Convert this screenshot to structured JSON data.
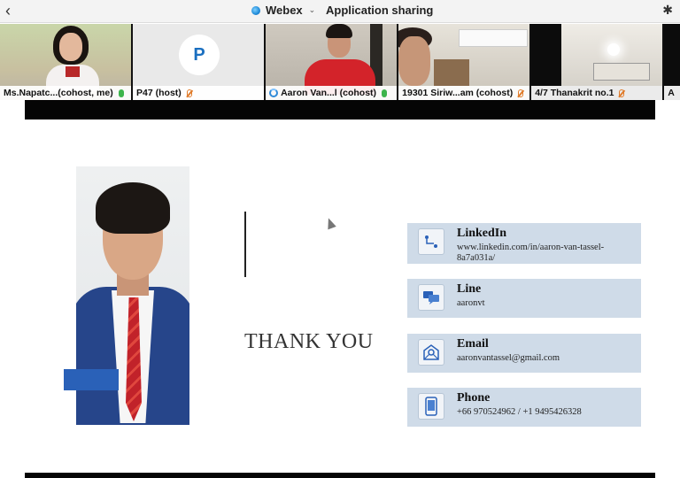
{
  "topbar": {
    "app_name": "Webex",
    "chevron": "⌄",
    "sub_title": "Application sharing",
    "back_icon": "chevron-left-icon",
    "bluetooth_icon": "bluetooth-icon"
  },
  "participants": [
    {
      "label": "Ms.Napatc...(cohost, me)",
      "mic": "on"
    },
    {
      "label": "P47 (host)",
      "mic": "off",
      "avatar_letter": "P"
    },
    {
      "label": "Aaron Van...l (cohost)",
      "mic": "on"
    },
    {
      "label": "19301 Siriw...am (cohost)",
      "mic": "off"
    },
    {
      "label": "4/7 Thanakrit no.1",
      "mic": "off"
    },
    {
      "label": "A"
    }
  ],
  "slide": {
    "heading": "THANK YOU",
    "contacts": [
      {
        "title": "LinkedIn",
        "value": "www.linkedin.com/in/aaron-van-tassel-8a7a031a/",
        "icon": "linkedin-icon"
      },
      {
        "title": "Line",
        "value": "aaronvt",
        "icon": "chat-icon"
      },
      {
        "title": "Email",
        "value": "aaronvantassel@gmail.com",
        "icon": "email-icon"
      },
      {
        "title": "Phone",
        "value": "+66 970524962 / +1 9495426328",
        "icon": "phone-icon"
      }
    ]
  },
  "colors": {
    "accent_blue": "#2a61b8",
    "card_bg": "#cfdbe8",
    "mic_on": "#3cb44b",
    "mic_off": "#e07b2a"
  }
}
